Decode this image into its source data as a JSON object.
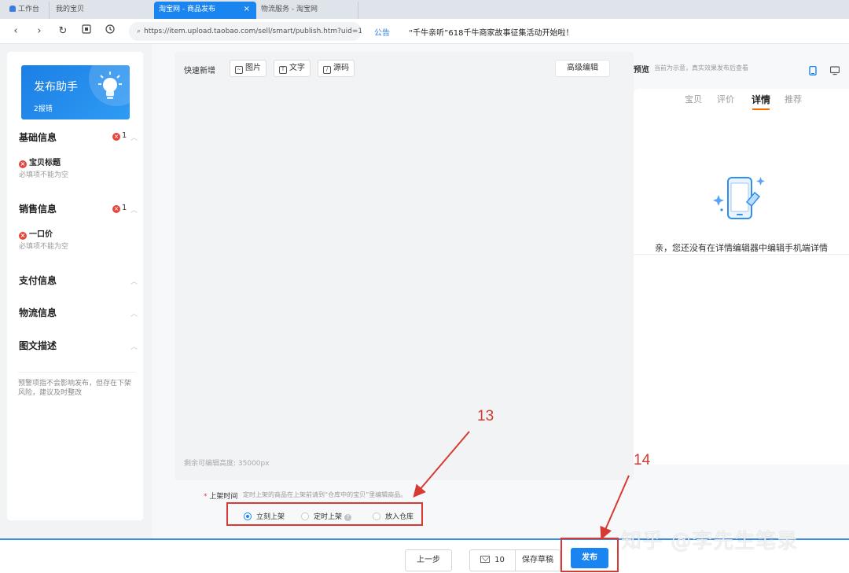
{
  "browser": {
    "tabs": [
      {
        "label": "工作台"
      },
      {
        "label": "我的宝贝"
      },
      {
        "label": "淘宝网 - 商品发布",
        "active": true
      },
      {
        "label": "物流服务 - 淘宝网"
      }
    ],
    "close_glyph": "×",
    "url": "https://item.upload.taobao.com/sell/smart/publish.htm?uid=16",
    "notice_label": "公告",
    "notice_text": "“千牛亲听”618千牛商家故事征集活动开始啦！"
  },
  "sidebar": {
    "assistant_title": "发布助手",
    "assistant_sub": "2报错",
    "sections": [
      {
        "title": "基础信息",
        "error_count": "1",
        "error_item": "宝贝标题",
        "error_hint": "必填项不能为空"
      },
      {
        "title": "销售信息",
        "error_count": "1",
        "error_item": "一口价",
        "error_hint": "必填项不能为空"
      },
      {
        "title": "支付信息"
      },
      {
        "title": "物流信息"
      },
      {
        "title": "图文描述"
      }
    ],
    "footer_note": "预警项指不会影响发布，但存在下架风险，建议及时整改"
  },
  "editor": {
    "quick_label": "快速新增",
    "buttons": [
      "图片",
      "文字",
      "源码"
    ],
    "advanced": "高级编辑",
    "remain": "剩余可编辑高度: 35000px"
  },
  "preview": {
    "title": "预览",
    "note": "当前为示意，真实效果发布后查看",
    "tabs": [
      "宝贝",
      "评价",
      "详情",
      "推荐"
    ],
    "active_tab": "详情",
    "empty_text": "亲，您还没有在详情编辑器中编辑手机端详情"
  },
  "listing": {
    "label": "上架时间",
    "required_mark": "*",
    "note": "定时上架的商品在上架前请到“仓库中的宝贝”里编辑商品。",
    "options": [
      "立刻上架",
      "定时上架",
      "放入仓库"
    ],
    "selected": "立刻上架"
  },
  "footer": {
    "prev": "上一步",
    "drafts_count": "10",
    "save_draft": "保存草稿",
    "publish": "发布"
  },
  "annotations": {
    "n13": "13",
    "n14": "14"
  },
  "watermark": "知乎 @李先生笔录",
  "colors": {
    "accent": "#1a85f0",
    "annotation": "#d63a32",
    "error": "#e5463a",
    "tab_underline": "#ff6a00"
  }
}
